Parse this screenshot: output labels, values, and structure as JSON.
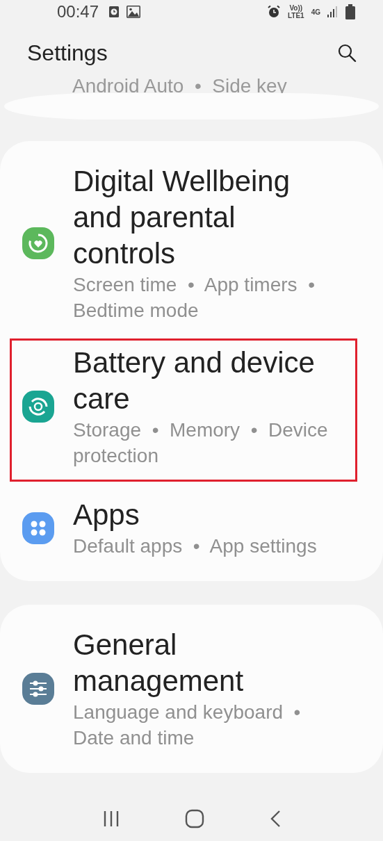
{
  "status_bar": {
    "time": "00:47",
    "notifications": [
      {
        "kind": "clock"
      },
      {
        "kind": "image"
      }
    ],
    "network": {
      "volte": "Vo))",
      "lte": "LTE1",
      "gen": "4G"
    }
  },
  "header": {
    "title": "Settings"
  },
  "cut_off_item": {
    "subtitle": "Android Auto  •  Side key"
  },
  "groups": [
    {
      "items": [
        {
          "title": "Digital Wellbeing and parental controls",
          "subtitle": "Screen time  •  App timers  •  Bedtime mode",
          "kind": "wellbeing",
          "color": "#5cb85c",
          "highlighted": false
        },
        {
          "title": "Battery and device care",
          "subtitle": "Storage  •  Memory  •  Device protection",
          "kind": "care",
          "color": "#1aa592",
          "highlighted": true
        },
        {
          "title": "Apps",
          "subtitle": "Default apps  •  App settings",
          "kind": "apps",
          "color": "#5b9cf0",
          "highlighted": false
        }
      ]
    },
    {
      "items": [
        {
          "title": "General management",
          "subtitle": "Language and keyboard  •  Date and time",
          "kind": "general",
          "color": "#5a7d96",
          "highlighted": false
        }
      ]
    }
  ]
}
